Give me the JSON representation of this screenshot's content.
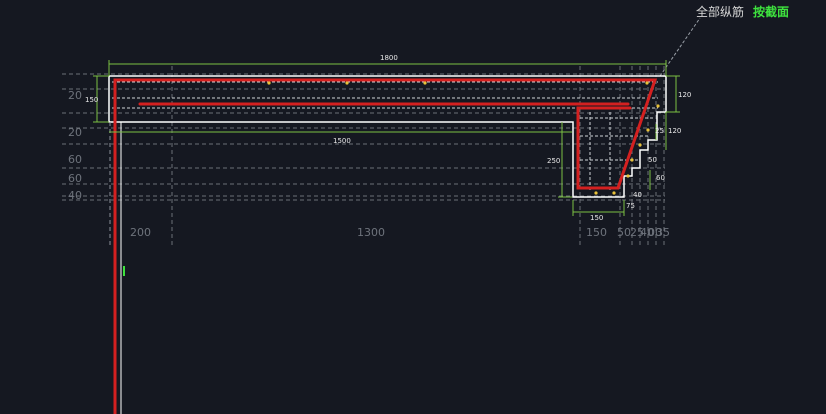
{
  "header": {
    "all_rebar": "全部纵筋",
    "by_section": "按截面"
  },
  "dims": {
    "top_total": "1800",
    "left_height": "150",
    "inner_length": "1500",
    "right_height": "120",
    "right_step_1": "25",
    "right_step_2": "120",
    "groove_depth": "250",
    "step_a": "50",
    "step_b": "60",
    "bottom_width": "150",
    "small_40": "40",
    "small_75": "75"
  },
  "left_ticks": [
    "20",
    "20",
    "60",
    "60",
    "40"
  ],
  "bottom_ticks": {
    "a": "200",
    "b": "1300",
    "c": "150",
    "d": "50",
    "e": "25",
    "f": "40",
    "g": "00",
    "h": "35"
  },
  "colors": {
    "background": "#151821",
    "outline": "#ffffff",
    "rebar": "#d42020",
    "dimension": "#7bc043",
    "grid": "#8a8f99",
    "highlight": "#3ee23e"
  }
}
